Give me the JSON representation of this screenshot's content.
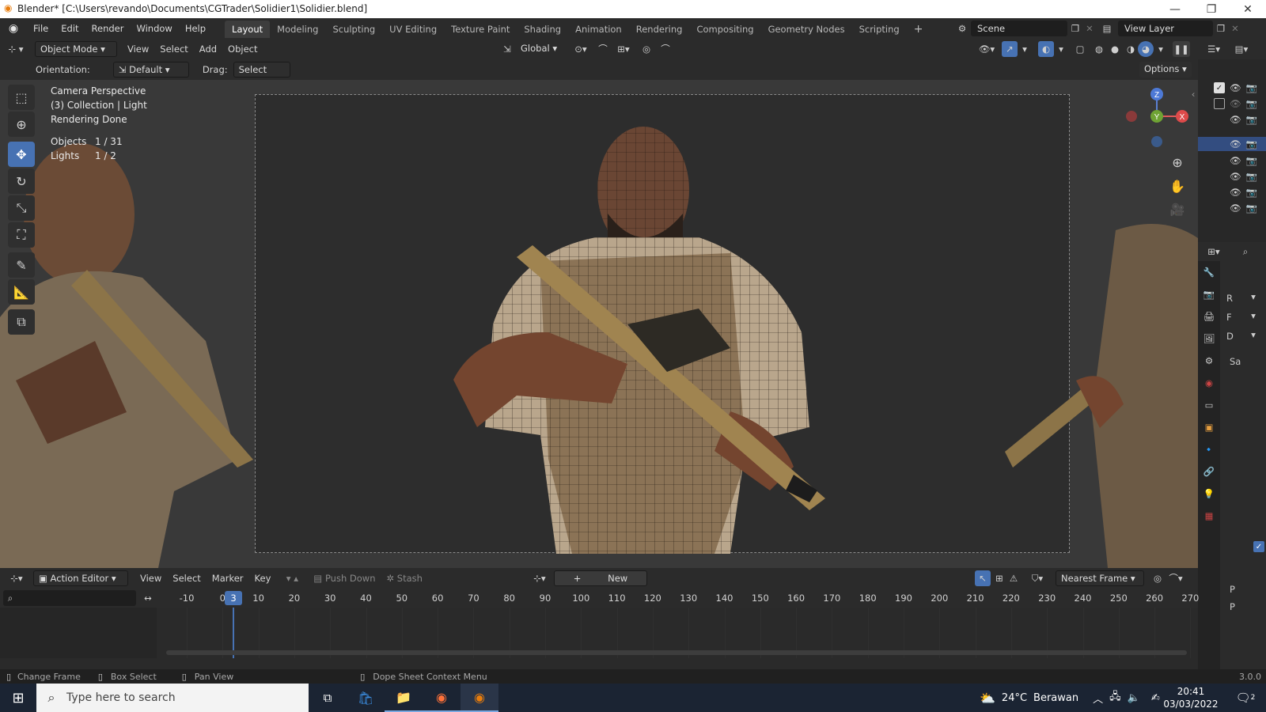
{
  "window": {
    "title": "Blender* [C:\\Users\\revando\\Documents\\CGTrader\\Solidier1\\Solidier.blend]"
  },
  "menu": [
    "File",
    "Edit",
    "Render",
    "Window",
    "Help"
  ],
  "workspaces": [
    "Layout",
    "Modeling",
    "Sculpting",
    "UV Editing",
    "Texture Paint",
    "Shading",
    "Animation",
    "Rendering",
    "Compositing",
    "Geometry Nodes",
    "Scripting"
  ],
  "scene": {
    "name": "Scene",
    "view_layer": "View Layer"
  },
  "viewport_header": {
    "mode": "Object Mode",
    "menus": [
      "View",
      "Select",
      "Add",
      "Object"
    ],
    "transform_orientation": "Global"
  },
  "tool_settings": {
    "orientation_label": "Orientation:",
    "orientation_value": "Default",
    "drag_label": "Drag:",
    "drag_value": "Select Box",
    "options": "Options"
  },
  "overlay": {
    "line1": "Camera Perspective",
    "line2": "(3) Collection | Light",
    "line3": "Rendering Done",
    "objects_label": "Objects",
    "objects_value": "1 / 31",
    "lights_label": "Lights",
    "lights_value": "1 / 2"
  },
  "gizmo": {
    "x": "X",
    "y": "Y",
    "z": "Z"
  },
  "props_labels": [
    "R",
    "F",
    "D",
    "Sa",
    "P",
    "P"
  ],
  "timeline_header": {
    "editor": "Action Editor",
    "menus": [
      "View",
      "Select",
      "Marker",
      "Key"
    ],
    "push_down": "Push Down",
    "stash": "Stash",
    "new": "New",
    "snap": "Nearest Frame"
  },
  "timeline": {
    "current_frame": "3",
    "ticks": [
      "-10",
      "0",
      "10",
      "20",
      "30",
      "40",
      "50",
      "60",
      "70",
      "80",
      "90",
      "100",
      "110",
      "120",
      "130",
      "140",
      "150",
      "160",
      "170",
      "180",
      "190",
      "200",
      "210",
      "220",
      "230",
      "240",
      "250",
      "260",
      "270"
    ]
  },
  "status": {
    "change_frame": "Change Frame",
    "box_select": "Box Select",
    "pan_view": "Pan View",
    "context_menu": "Dope Sheet Context Menu",
    "version": "3.0.0"
  },
  "taskbar": {
    "search_placeholder": "Type here to search",
    "weather_temp": "24°C",
    "weather_desc": "Berawan",
    "time": "20:41",
    "date": "03/03/2022",
    "notifications": "2"
  },
  "colors": {
    "accent": "#4772b3",
    "header": "#2b2b2b",
    "viewport": "#393939"
  }
}
